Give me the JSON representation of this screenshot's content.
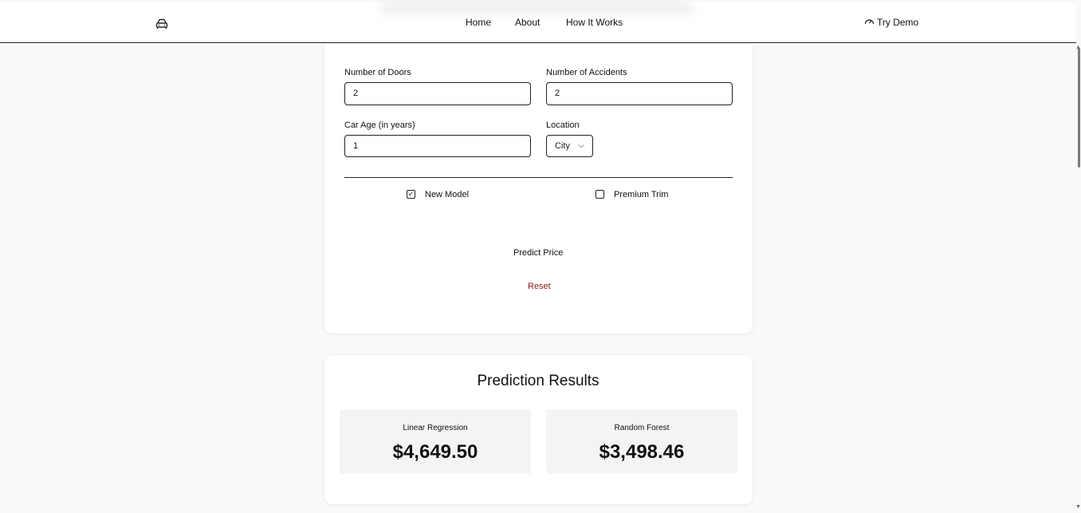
{
  "nav": {
    "links": [
      "Home",
      "About",
      "How It Works"
    ],
    "try_demo": "Try Demo"
  },
  "form": {
    "doors_label": "Number of Doors",
    "doors_value": "2",
    "accidents_label": "Number of Accidents",
    "accidents_value": "2",
    "age_label": "Car Age (in years)",
    "age_value": "1",
    "location_label": "Location",
    "location_value": "City",
    "new_model_label": "New Model",
    "new_model_checked": true,
    "premium_trim_label": "Premium Trim",
    "premium_trim_checked": false,
    "predict_label": "Predict Price",
    "reset_label": "Reset"
  },
  "results": {
    "title": "Prediction Results",
    "models": [
      {
        "name": "Linear Regression",
        "price": "$4,649.50"
      },
      {
        "name": "Random Forest",
        "price": "$3,498.46"
      }
    ]
  },
  "colors": {
    "accent_reset": "#8b1a1a",
    "background": "#f8f9fb"
  }
}
